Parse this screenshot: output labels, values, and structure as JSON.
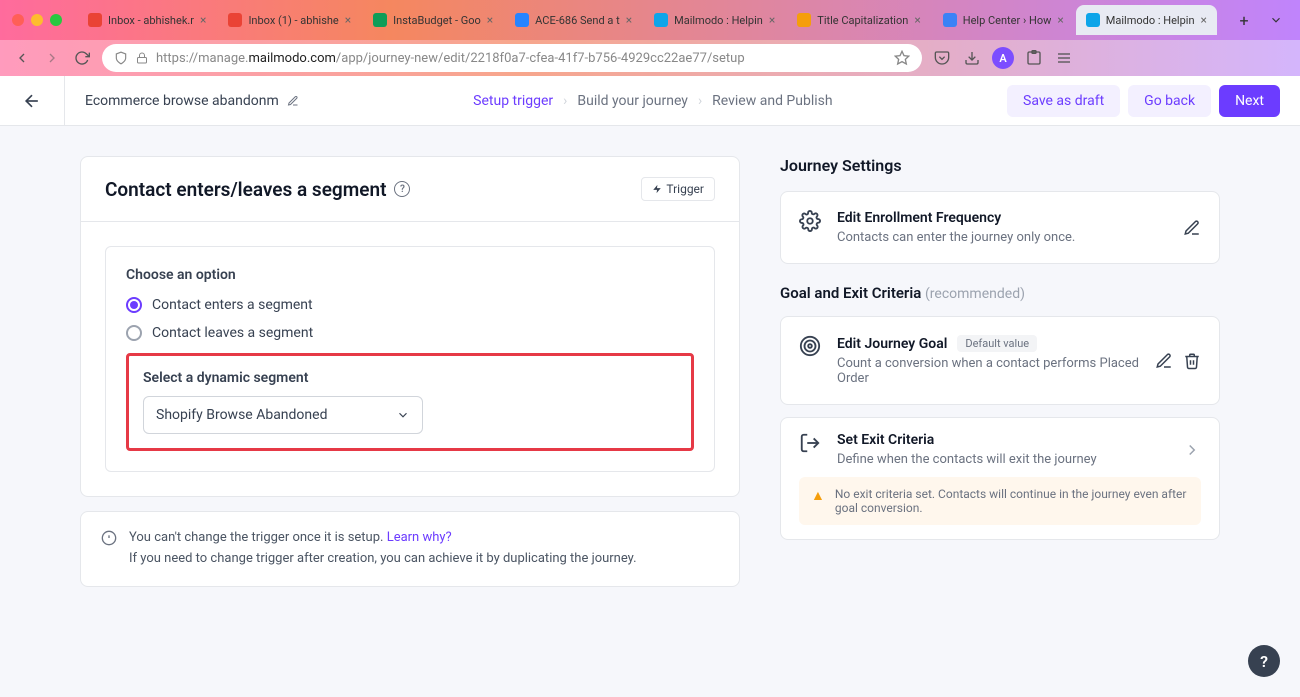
{
  "browser": {
    "tabs": [
      {
        "label": "Inbox - abhishek.r",
        "favicon": "#ea4335"
      },
      {
        "label": "Inbox (1) - abhishe",
        "favicon": "#ea4335"
      },
      {
        "label": "InstaBudget - Goo",
        "favicon": "#0f9d58"
      },
      {
        "label": "ACE-686 Send a t",
        "favicon": "#2684ff"
      },
      {
        "label": "Mailmodo : Helpin",
        "favicon": "#0ea5e9"
      },
      {
        "label": "Title Capitalization",
        "favicon": "#f59e0b"
      },
      {
        "label": "Help Center › How",
        "favicon": "#3b82f6"
      },
      {
        "label": "Mailmodo : Helpin",
        "favicon": "#0ea5e9"
      }
    ],
    "url_pre": "https://manage.",
    "url_domain": "mailmodo.com",
    "url_path": "/app/journey-new/edit/2218f0a7-cfea-41f7-b756-4929cc22ae77/setup",
    "avatar": "A"
  },
  "header": {
    "journey_name": "Ecommerce browse abandonm",
    "crumbs": [
      "Setup trigger",
      "Build your journey",
      "Review and Publish"
    ],
    "save_draft": "Save as draft",
    "go_back": "Go back",
    "next": "Next"
  },
  "trigger_card": {
    "title": "Contact enters/leaves a segment",
    "badge": "Trigger",
    "choose_label": "Choose an option",
    "opt_enter": "Contact enters a segment",
    "opt_leave": "Contact leaves a segment",
    "select_label": "Select a dynamic segment",
    "dropdown_value": "Shopify Browse Abandoned"
  },
  "info": {
    "line1": "You can't change the trigger once it is setup. ",
    "learn": "Learn why?",
    "line2": "If you need to change trigger after creation, you can achieve it by duplicating the journey."
  },
  "settings": {
    "heading": "Journey Settings",
    "enrollment_title": "Edit Enrollment Frequency",
    "enrollment_sub": "Contacts can enter the journey only once.",
    "goal_heading": "Goal and Exit Criteria",
    "goal_rec": "(recommended)",
    "goal_title": "Edit Journey Goal",
    "goal_default": "Default value",
    "goal_sub": "Count a conversion when a contact performs Placed Order",
    "exit_title": "Set Exit Criteria",
    "exit_sub": "Define when the contacts will exit the journey",
    "exit_warning": "No exit criteria set. Contacts will continue in the journey even after goal conversion."
  }
}
